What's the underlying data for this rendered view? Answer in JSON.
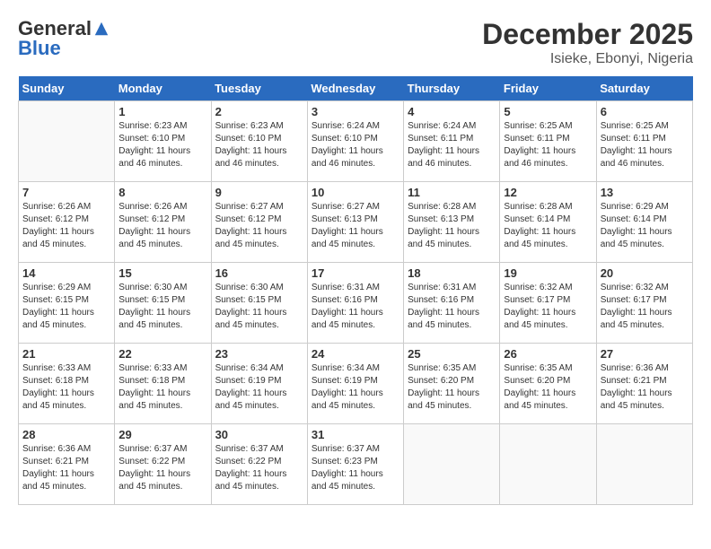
{
  "logo": {
    "general": "General",
    "blue": "Blue"
  },
  "title": "December 2025",
  "subtitle": "Isieke, Ebonyi, Nigeria",
  "days": [
    "Sunday",
    "Monday",
    "Tuesday",
    "Wednesday",
    "Thursday",
    "Friday",
    "Saturday"
  ],
  "weeks": [
    [
      {
        "date": "",
        "sunrise": "",
        "sunset": "",
        "daylight": ""
      },
      {
        "date": "1",
        "sunrise": "Sunrise: 6:23 AM",
        "sunset": "Sunset: 6:10 PM",
        "daylight": "Daylight: 11 hours and 46 minutes."
      },
      {
        "date": "2",
        "sunrise": "Sunrise: 6:23 AM",
        "sunset": "Sunset: 6:10 PM",
        "daylight": "Daylight: 11 hours and 46 minutes."
      },
      {
        "date": "3",
        "sunrise": "Sunrise: 6:24 AM",
        "sunset": "Sunset: 6:10 PM",
        "daylight": "Daylight: 11 hours and 46 minutes."
      },
      {
        "date": "4",
        "sunrise": "Sunrise: 6:24 AM",
        "sunset": "Sunset: 6:11 PM",
        "daylight": "Daylight: 11 hours and 46 minutes."
      },
      {
        "date": "5",
        "sunrise": "Sunrise: 6:25 AM",
        "sunset": "Sunset: 6:11 PM",
        "daylight": "Daylight: 11 hours and 46 minutes."
      },
      {
        "date": "6",
        "sunrise": "Sunrise: 6:25 AM",
        "sunset": "Sunset: 6:11 PM",
        "daylight": "Daylight: 11 hours and 46 minutes."
      }
    ],
    [
      {
        "date": "7",
        "sunrise": "Sunrise: 6:26 AM",
        "sunset": "Sunset: 6:12 PM",
        "daylight": "Daylight: 11 hours and 45 minutes."
      },
      {
        "date": "8",
        "sunrise": "Sunrise: 6:26 AM",
        "sunset": "Sunset: 6:12 PM",
        "daylight": "Daylight: 11 hours and 45 minutes."
      },
      {
        "date": "9",
        "sunrise": "Sunrise: 6:27 AM",
        "sunset": "Sunset: 6:12 PM",
        "daylight": "Daylight: 11 hours and 45 minutes."
      },
      {
        "date": "10",
        "sunrise": "Sunrise: 6:27 AM",
        "sunset": "Sunset: 6:13 PM",
        "daylight": "Daylight: 11 hours and 45 minutes."
      },
      {
        "date": "11",
        "sunrise": "Sunrise: 6:28 AM",
        "sunset": "Sunset: 6:13 PM",
        "daylight": "Daylight: 11 hours and 45 minutes."
      },
      {
        "date": "12",
        "sunrise": "Sunrise: 6:28 AM",
        "sunset": "Sunset: 6:14 PM",
        "daylight": "Daylight: 11 hours and 45 minutes."
      },
      {
        "date": "13",
        "sunrise": "Sunrise: 6:29 AM",
        "sunset": "Sunset: 6:14 PM",
        "daylight": "Daylight: 11 hours and 45 minutes."
      }
    ],
    [
      {
        "date": "14",
        "sunrise": "Sunrise: 6:29 AM",
        "sunset": "Sunset: 6:15 PM",
        "daylight": "Daylight: 11 hours and 45 minutes."
      },
      {
        "date": "15",
        "sunrise": "Sunrise: 6:30 AM",
        "sunset": "Sunset: 6:15 PM",
        "daylight": "Daylight: 11 hours and 45 minutes."
      },
      {
        "date": "16",
        "sunrise": "Sunrise: 6:30 AM",
        "sunset": "Sunset: 6:15 PM",
        "daylight": "Daylight: 11 hours and 45 minutes."
      },
      {
        "date": "17",
        "sunrise": "Sunrise: 6:31 AM",
        "sunset": "Sunset: 6:16 PM",
        "daylight": "Daylight: 11 hours and 45 minutes."
      },
      {
        "date": "18",
        "sunrise": "Sunrise: 6:31 AM",
        "sunset": "Sunset: 6:16 PM",
        "daylight": "Daylight: 11 hours and 45 minutes."
      },
      {
        "date": "19",
        "sunrise": "Sunrise: 6:32 AM",
        "sunset": "Sunset: 6:17 PM",
        "daylight": "Daylight: 11 hours and 45 minutes."
      },
      {
        "date": "20",
        "sunrise": "Sunrise: 6:32 AM",
        "sunset": "Sunset: 6:17 PM",
        "daylight": "Daylight: 11 hours and 45 minutes."
      }
    ],
    [
      {
        "date": "21",
        "sunrise": "Sunrise: 6:33 AM",
        "sunset": "Sunset: 6:18 PM",
        "daylight": "Daylight: 11 hours and 45 minutes."
      },
      {
        "date": "22",
        "sunrise": "Sunrise: 6:33 AM",
        "sunset": "Sunset: 6:18 PM",
        "daylight": "Daylight: 11 hours and 45 minutes."
      },
      {
        "date": "23",
        "sunrise": "Sunrise: 6:34 AM",
        "sunset": "Sunset: 6:19 PM",
        "daylight": "Daylight: 11 hours and 45 minutes."
      },
      {
        "date": "24",
        "sunrise": "Sunrise: 6:34 AM",
        "sunset": "Sunset: 6:19 PM",
        "daylight": "Daylight: 11 hours and 45 minutes."
      },
      {
        "date": "25",
        "sunrise": "Sunrise: 6:35 AM",
        "sunset": "Sunset: 6:20 PM",
        "daylight": "Daylight: 11 hours and 45 minutes."
      },
      {
        "date": "26",
        "sunrise": "Sunrise: 6:35 AM",
        "sunset": "Sunset: 6:20 PM",
        "daylight": "Daylight: 11 hours and 45 minutes."
      },
      {
        "date": "27",
        "sunrise": "Sunrise: 6:36 AM",
        "sunset": "Sunset: 6:21 PM",
        "daylight": "Daylight: 11 hours and 45 minutes."
      }
    ],
    [
      {
        "date": "28",
        "sunrise": "Sunrise: 6:36 AM",
        "sunset": "Sunset: 6:21 PM",
        "daylight": "Daylight: 11 hours and 45 minutes."
      },
      {
        "date": "29",
        "sunrise": "Sunrise: 6:37 AM",
        "sunset": "Sunset: 6:22 PM",
        "daylight": "Daylight: 11 hours and 45 minutes."
      },
      {
        "date": "30",
        "sunrise": "Sunrise: 6:37 AM",
        "sunset": "Sunset: 6:22 PM",
        "daylight": "Daylight: 11 hours and 45 minutes."
      },
      {
        "date": "31",
        "sunrise": "Sunrise: 6:37 AM",
        "sunset": "Sunset: 6:23 PM",
        "daylight": "Daylight: 11 hours and 45 minutes."
      },
      {
        "date": "",
        "sunrise": "",
        "sunset": "",
        "daylight": ""
      },
      {
        "date": "",
        "sunrise": "",
        "sunset": "",
        "daylight": ""
      },
      {
        "date": "",
        "sunrise": "",
        "sunset": "",
        "daylight": ""
      }
    ]
  ]
}
